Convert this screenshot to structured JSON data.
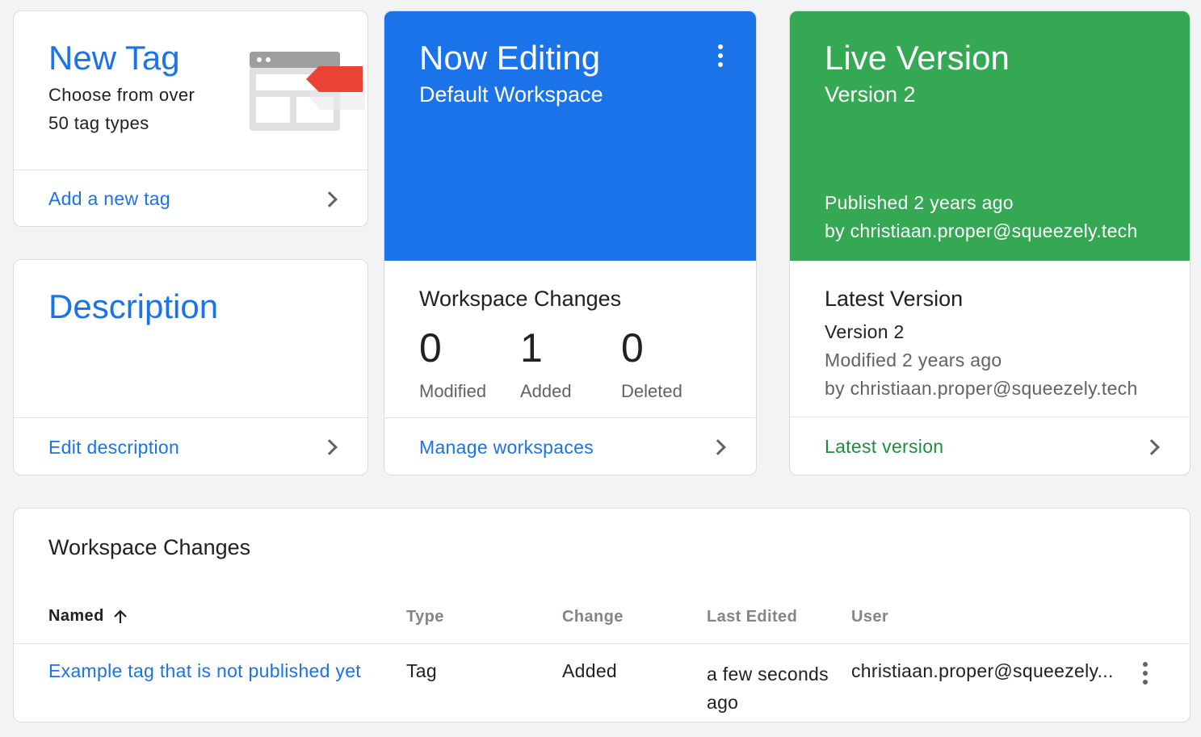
{
  "new_tag": {
    "title": "New Tag",
    "subtitle_line1": "Choose from over",
    "subtitle_line2": "50 tag types",
    "link": "Add a new tag",
    "icon": "tag-browser-illustration"
  },
  "description": {
    "title": "Description",
    "link": "Edit description"
  },
  "now_editing": {
    "title": "Now Editing",
    "workspace": "Default Workspace",
    "accent": "#1a73e8",
    "changes_title": "Workspace Changes",
    "stats": [
      {
        "value": "0",
        "label": "Modified"
      },
      {
        "value": "1",
        "label": "Added"
      },
      {
        "value": "0",
        "label": "Deleted"
      }
    ],
    "link": "Manage workspaces"
  },
  "live_version": {
    "title": "Live Version",
    "version": "Version 2",
    "published": "Published 2 years ago",
    "by": "by christiaan.proper@squeezely.tech",
    "accent": "#34a853",
    "latest_title": "Latest Version",
    "latest_version": "Version 2",
    "modified": "Modified 2 years ago",
    "modified_by": "by christiaan.proper@squeezely.tech",
    "link": "Latest version"
  },
  "changes_table": {
    "title": "Workspace Changes",
    "columns": [
      "Named",
      "Type",
      "Change",
      "Last Edited",
      "User"
    ],
    "rows": [
      {
        "name": "Example tag that is not published yet",
        "type": "Tag",
        "change": "Added",
        "last_edited_line1": "a few seconds",
        "last_edited_line2": "ago",
        "user": "christiaan.proper@squeezely..."
      }
    ]
  }
}
